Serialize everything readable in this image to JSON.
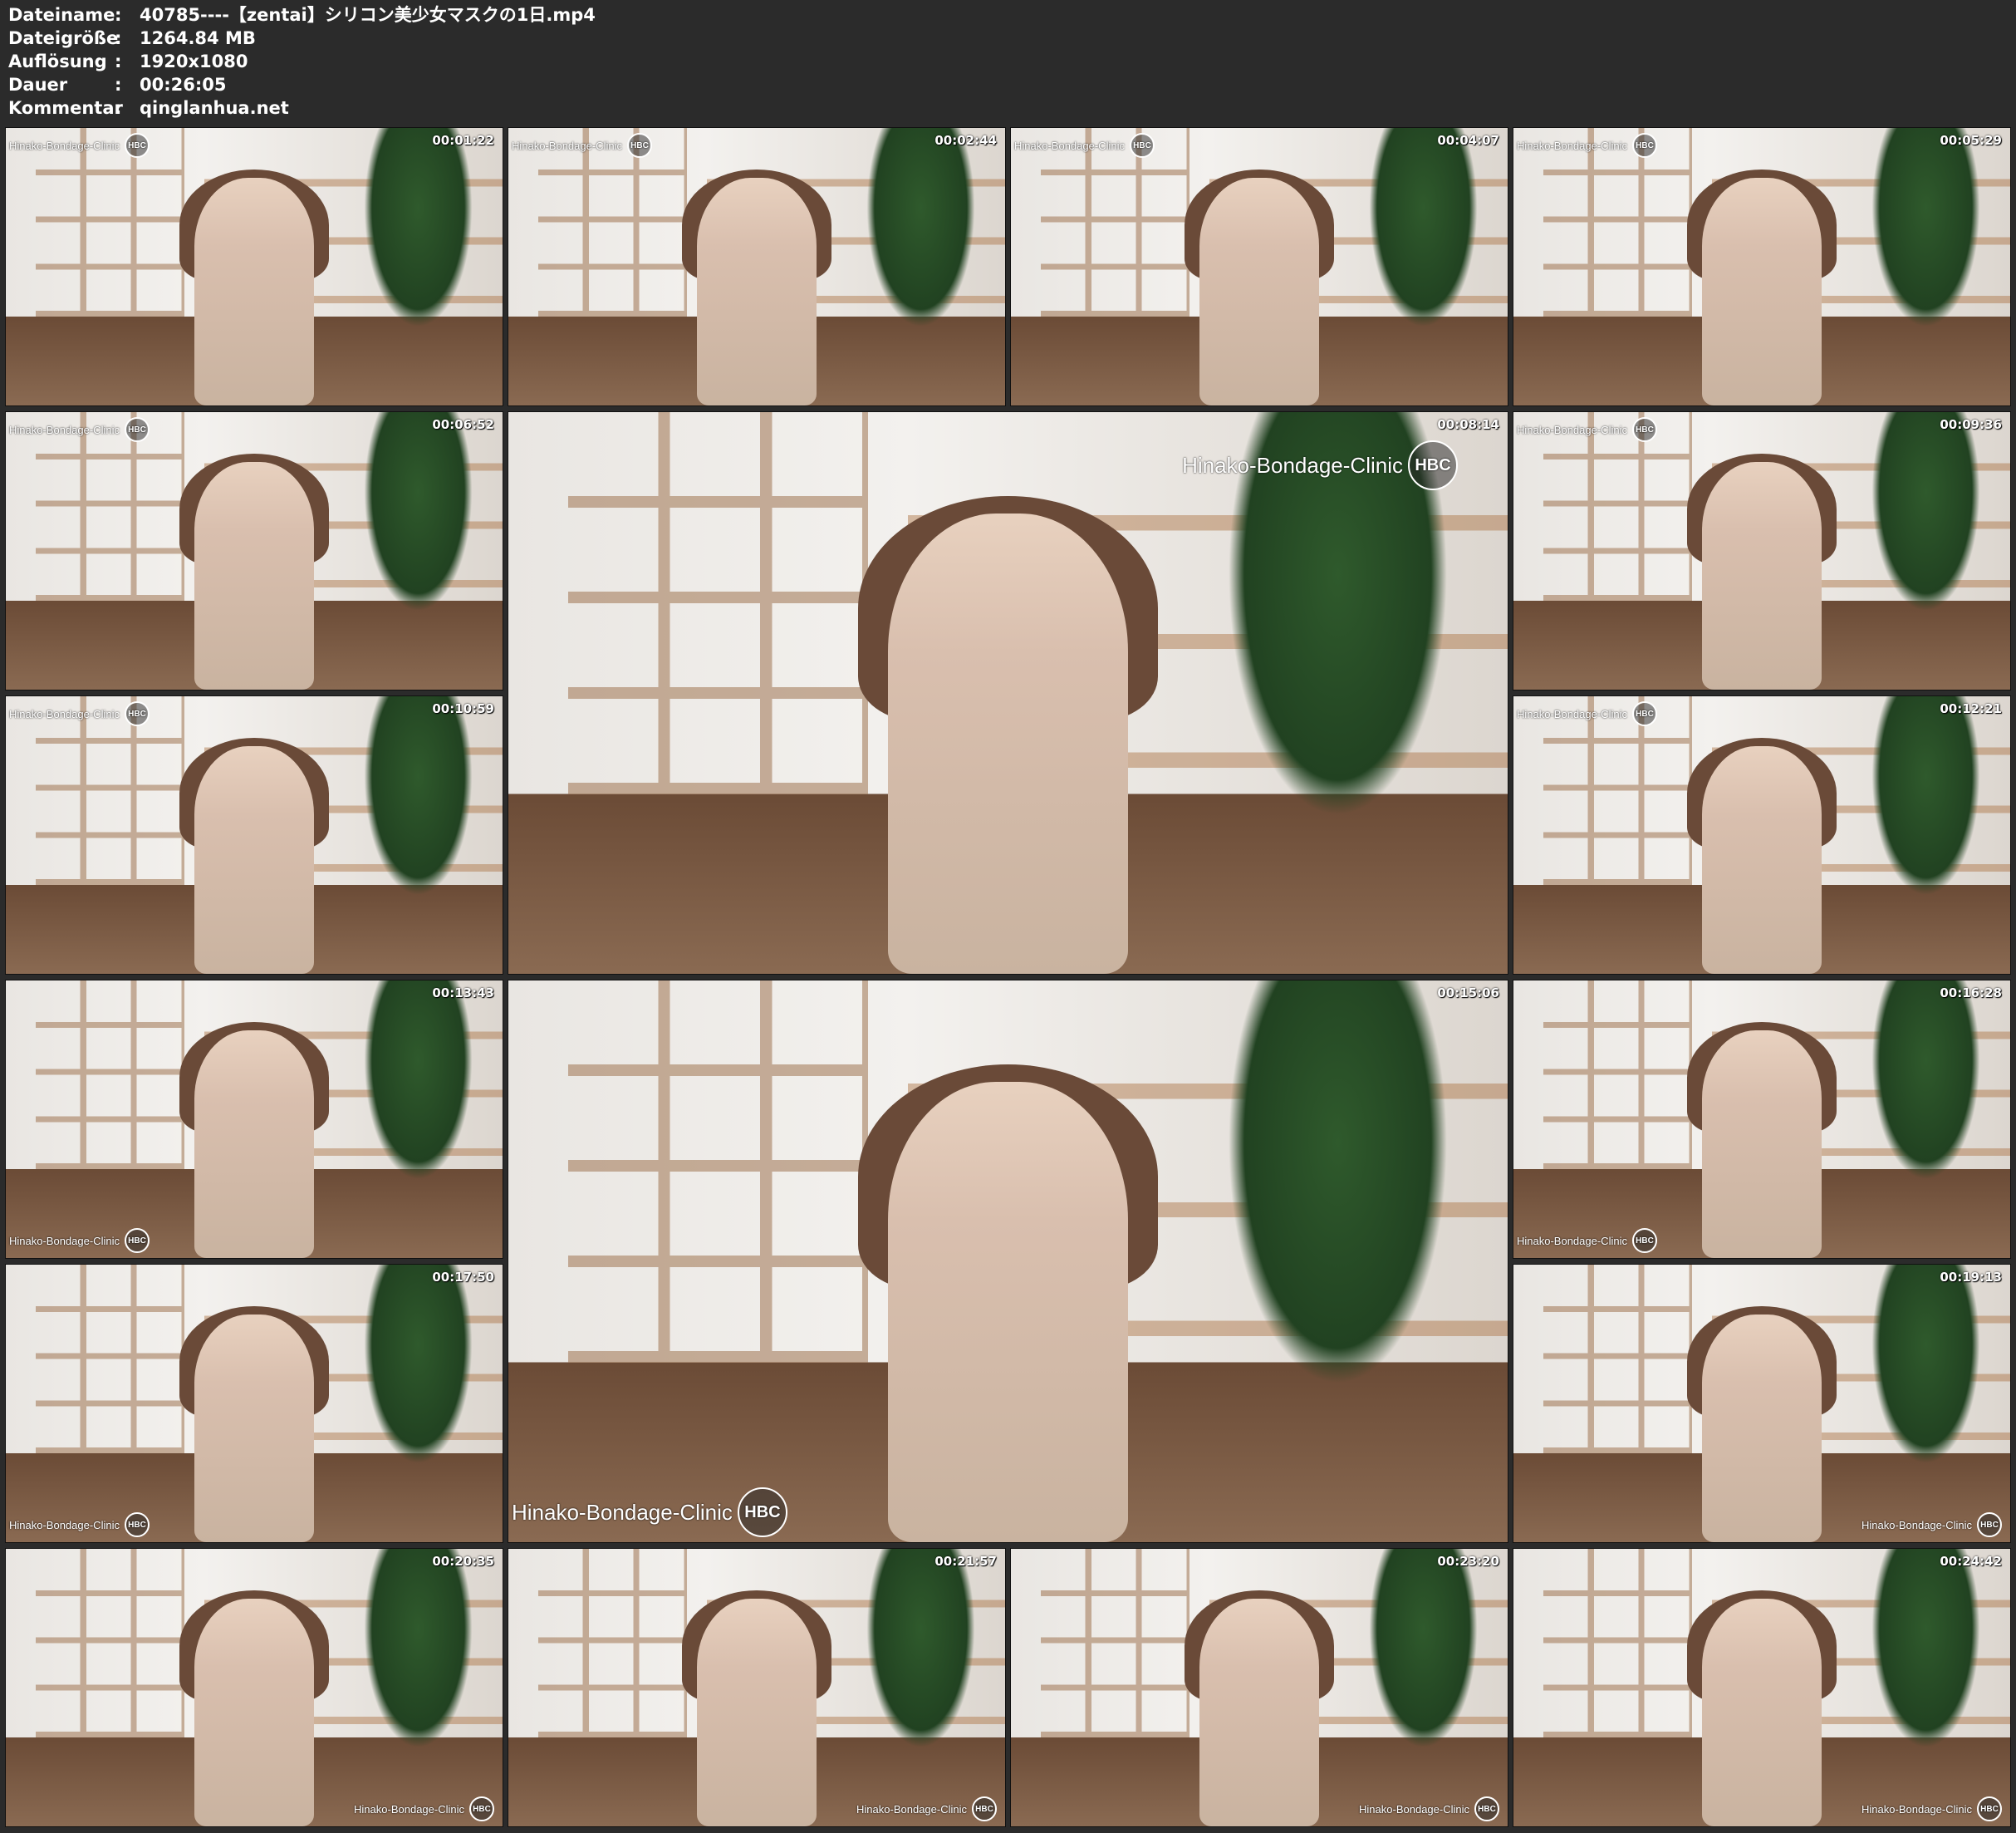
{
  "meta": [
    {
      "label": "Dateiname",
      "sep": ":",
      "value": "40785----【zentai】シリコン美少女マスクの1日.mp4"
    },
    {
      "label": "Dateigröße",
      "sep": ":",
      "value": "1264.84 MB"
    },
    {
      "label": "Auflösung",
      "sep": ":",
      "value": "1920x1080"
    },
    {
      "label": "Dauer",
      "sep": ":",
      "value": "00:26:05"
    },
    {
      "label": "Kommentar",
      "sep": ":",
      "value": "qinglanhua.net"
    }
  ],
  "watermark": {
    "text": "Hinako-Bondage-Clinic",
    "logo": "HBC"
  },
  "frames": [
    {
      "time": "00:01:22",
      "wm": "top"
    },
    {
      "time": "00:02:44",
      "wm": "top"
    },
    {
      "time": "00:04:07",
      "wm": "top"
    },
    {
      "time": "00:05:29",
      "wm": "top"
    },
    {
      "time": "00:06:52",
      "wm": "top"
    },
    {
      "time": "00:08:14",
      "wm": "top-right"
    },
    {
      "time": "00:09:36",
      "wm": "top"
    },
    {
      "time": "00:10:59",
      "wm": "top"
    },
    {
      "time": "00:12:21",
      "wm": "top"
    },
    {
      "time": "00:13:43",
      "wm": "bottom"
    },
    {
      "time": "00:15:06",
      "wm": "bottom"
    },
    {
      "time": "00:16:28",
      "wm": "bottom"
    },
    {
      "time": "00:17:50",
      "wm": "bottom"
    },
    {
      "time": "00:19:13",
      "wm": "bottom-right"
    },
    {
      "time": "00:20:35",
      "wm": "bottom-right"
    },
    {
      "time": "00:21:57",
      "wm": "bottom-right"
    },
    {
      "time": "00:23:20",
      "wm": "bottom-right"
    },
    {
      "time": "00:24:42",
      "wm": "bottom-right"
    }
  ]
}
